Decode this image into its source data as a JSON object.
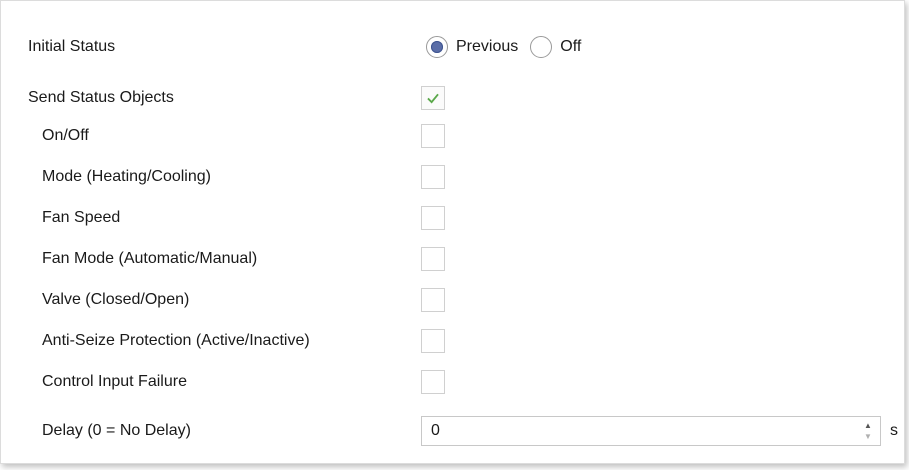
{
  "initial_status": {
    "label": "Initial Status",
    "options": [
      {
        "label": "Previous",
        "selected": true
      },
      {
        "label": "Off",
        "selected": false
      }
    ]
  },
  "send_status_objects": {
    "label": "Send Status Objects",
    "checked": true
  },
  "status_objects": [
    {
      "label": "On/Off",
      "checked": false
    },
    {
      "label": "Mode (Heating/Cooling)",
      "checked": false
    },
    {
      "label": "Fan Speed",
      "checked": false
    },
    {
      "label": "Fan Mode (Automatic/Manual)",
      "checked": false
    },
    {
      "label": "Valve (Closed/Open)",
      "checked": false
    },
    {
      "label": "Anti-Seize Protection (Active/Inactive)",
      "checked": false
    },
    {
      "label": "Control Input Failure",
      "checked": false
    }
  ],
  "delay": {
    "label": "Delay (0 = No Delay)",
    "value": "0",
    "unit": "s"
  },
  "colors": {
    "check_green": "#5aa84a",
    "radio_fill": "#5b6ea8",
    "border": "#d0d0d0"
  }
}
